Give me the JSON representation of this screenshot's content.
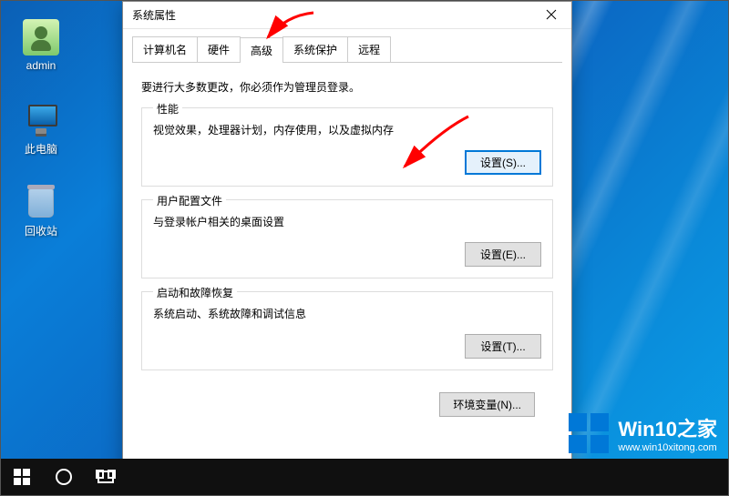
{
  "desktop": {
    "icons": [
      {
        "name": "admin-icon",
        "label": "admin"
      },
      {
        "name": "this-pc-icon",
        "label": "此电脑"
      },
      {
        "name": "recycle-bin-icon",
        "label": "回收站"
      }
    ]
  },
  "dialog": {
    "title": "系统属性",
    "tabs": [
      {
        "label": "计算机名",
        "active": false
      },
      {
        "label": "硬件",
        "active": false
      },
      {
        "label": "高级",
        "active": true
      },
      {
        "label": "系统保护",
        "active": false
      },
      {
        "label": "远程",
        "active": false
      }
    ],
    "intro": "要进行大多数更改，你必须作为管理员登录。",
    "groups": {
      "performance": {
        "legend": "性能",
        "desc": "视觉效果，处理器计划，内存使用，以及虚拟内存",
        "button": "设置(S)..."
      },
      "userprofiles": {
        "legend": "用户配置文件",
        "desc": "与登录帐户相关的桌面设置",
        "button": "设置(E)..."
      },
      "startup": {
        "legend": "启动和故障恢复",
        "desc": "系统启动、系统故障和调试信息",
        "button": "设置(T)..."
      }
    },
    "footer": {
      "envvars": "环境变量(N)..."
    }
  },
  "watermark": {
    "line1": "Win10之家",
    "line2": "www.win10xitong.com"
  },
  "annotations": {
    "arrow_color": "#ff0000"
  }
}
